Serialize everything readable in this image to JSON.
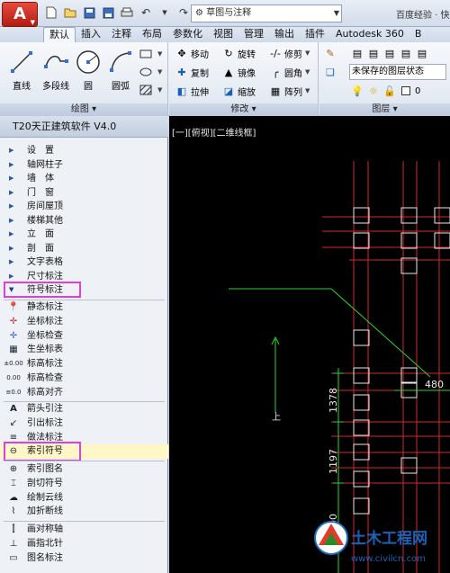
{
  "titlebar": {
    "app_button": "A",
    "workspace": "草图与注释",
    "title": "百度经验 · 快"
  },
  "tabs": [
    {
      "label": "默认",
      "active": true
    },
    {
      "label": "插入"
    },
    {
      "label": "注释"
    },
    {
      "label": "布局"
    },
    {
      "label": "参数化"
    },
    {
      "label": "视图"
    },
    {
      "label": "管理"
    },
    {
      "label": "输出"
    },
    {
      "label": "插件"
    },
    {
      "label": "Autodesk 360"
    },
    {
      "label": "B"
    }
  ],
  "ribbon": {
    "draw": {
      "title": "绘图 ▾",
      "line": "直线",
      "polyline": "多段线",
      "circle": "圆",
      "arc": "圆弧"
    },
    "modify": {
      "title": "修改 ▾",
      "move": "移动",
      "rotate": "旋转",
      "trim": "修剪",
      "copy": "复制",
      "mirror": "镜像",
      "fillet": "圆角",
      "stretch": "拉伸",
      "scale": "缩放",
      "array": "阵列"
    },
    "layer": {
      "title": "图层 ▾",
      "state": "未保存的图层状态",
      "current": "0"
    }
  },
  "palette": {
    "title": "T20天正建筑软件 V4.0",
    "menu": [
      "设　置",
      "轴网柱子",
      "墙　体",
      "门　窗",
      "房间屋顶",
      "楼梯其他",
      "立　面",
      "剖　面",
      "文字表格",
      "尺寸标注"
    ],
    "open_menu": "符号标注",
    "group1": [
      "静态标注",
      "坐标标注",
      "坐标检查",
      "生坐标表",
      "标高标注",
      "标高检查",
      "标高对齐"
    ],
    "group2": [
      "箭头引注",
      "引出标注",
      "做法标注",
      "索引符号"
    ],
    "highlighted": "索引符号",
    "group3": [
      "索引图名",
      "剖切符号",
      "绘制云线",
      "加折断线"
    ],
    "group4": [
      "画对称轴",
      "画指北针",
      "图名标注"
    ]
  },
  "canvas": {
    "viewport_label": "[一][俯视][二维线框]",
    "dimensions": [
      "1378",
      "1197",
      "1500",
      "480"
    ],
    "ucs_label": "上"
  },
  "watermark": {
    "name": "土木工程网",
    "url": "www.civilcn.com"
  },
  "colors": {
    "accent_red": "#c9231a",
    "highlight_box": "#e13fd6",
    "highlight_fill": "#fff8c6"
  }
}
